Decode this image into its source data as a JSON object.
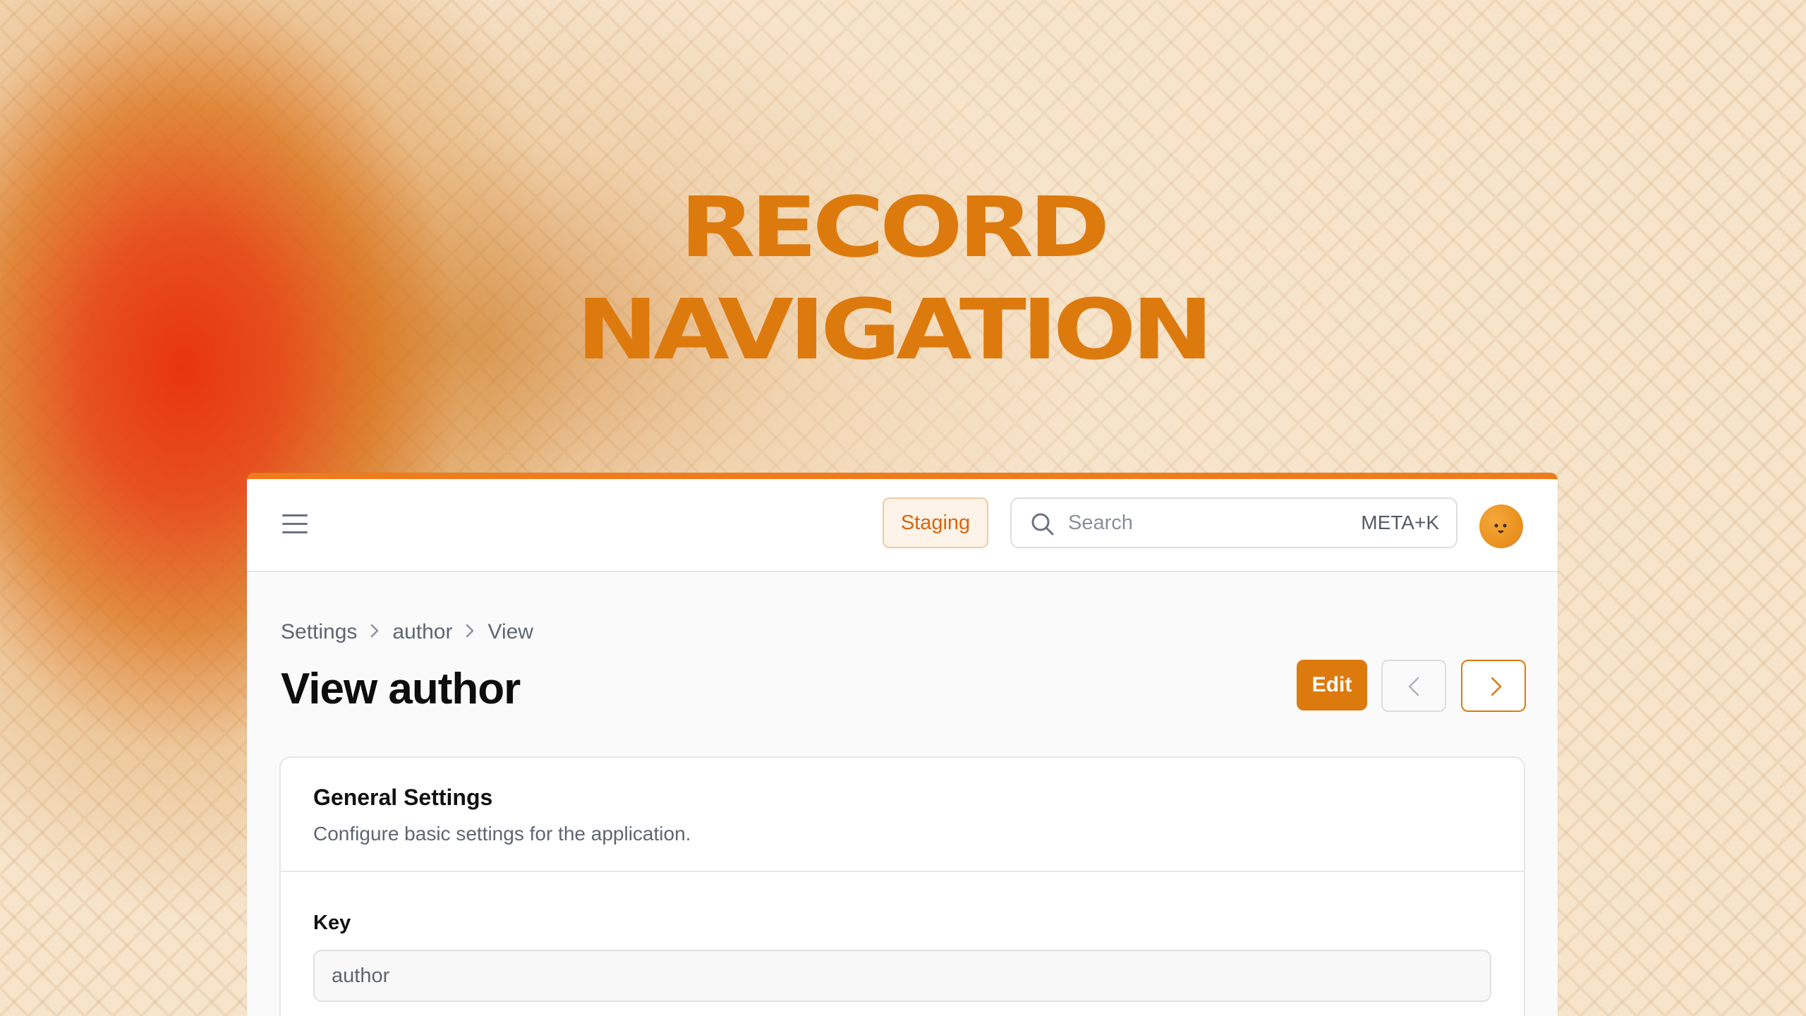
{
  "hero": {
    "line1": "RECORD",
    "line2": "NAVIGATION"
  },
  "colors": {
    "accent": "#dd7a0e",
    "accent_bar": "#ee7c1c",
    "background": "#f6e4cb"
  },
  "topbar": {
    "menu_icon": "hamburger-menu-icon",
    "environment_badge": "Staging",
    "search": {
      "placeholder": "Search",
      "shortcut": "META+K",
      "icon": "search-icon"
    },
    "avatar_icon": "user-avatar"
  },
  "breadcrumb": {
    "items": [
      "Settings",
      "author",
      "View"
    ],
    "separator_icon": "chevron-right-icon"
  },
  "page": {
    "title": "View author",
    "actions": {
      "edit_label": "Edit",
      "previous_icon": "chevron-left-icon",
      "next_icon": "chevron-right-icon"
    }
  },
  "card": {
    "title": "General Settings",
    "description": "Configure basic settings for the application.",
    "fields": [
      {
        "label": "Key",
        "value": "author"
      }
    ]
  }
}
